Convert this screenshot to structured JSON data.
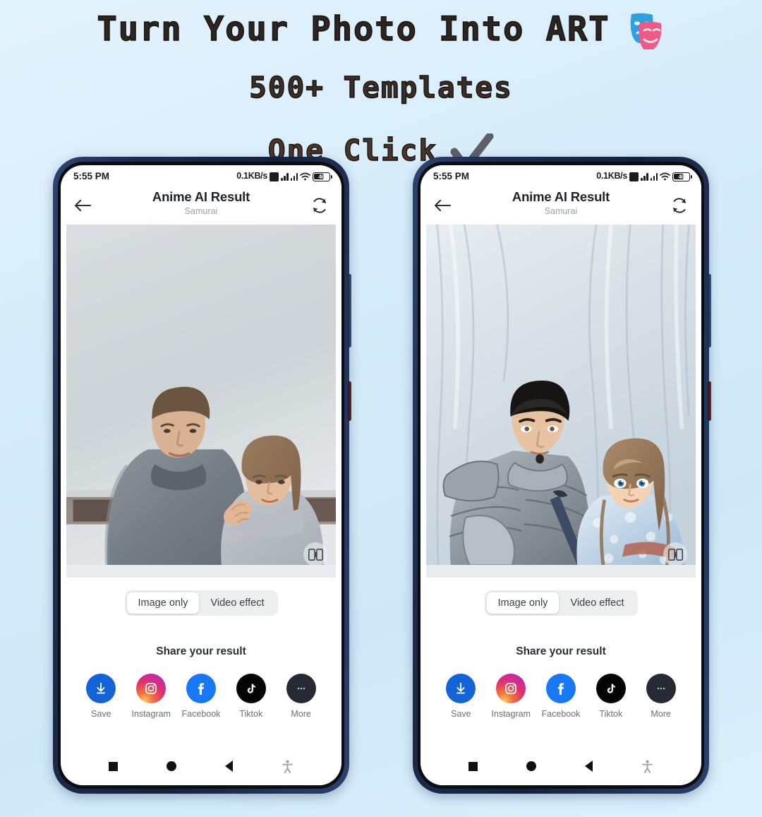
{
  "promo": {
    "headline_1": "Turn Your Photo Into ART",
    "headline_2": "500+ Templates",
    "headline_3": "One Click",
    "masks_icon": "theater-masks-icon",
    "check_icon": "checkmark-icon",
    "background_color": "#d9eefb"
  },
  "phone": {
    "status": {
      "time": "5:55 PM",
      "network_speed": "0.1KB/s",
      "battery_level": "46",
      "icons": [
        "sim-icon",
        "signal-bars-icon",
        "signal-bars-icon",
        "wifi-icon",
        "battery-icon"
      ]
    },
    "appbar": {
      "back": "back-arrow-icon",
      "title": "Anime AI Result",
      "subtitle": "Samurai",
      "refresh": "refresh-icon"
    },
    "artwork": {
      "compare_badge": "compare-toggle-icon"
    },
    "segmented": {
      "options": [
        "Image only",
        "Video effect"
      ],
      "selected": "Image only"
    },
    "share": {
      "title": "Share your result",
      "items": [
        {
          "label": "Save",
          "icon": "download-icon",
          "color": "#1464d8"
        },
        {
          "label": "Instagram",
          "icon": "instagram-icon",
          "color": "#e1306c"
        },
        {
          "label": "Facebook",
          "icon": "facebook-icon",
          "color": "#1877f2"
        },
        {
          "label": "Tiktok",
          "icon": "tiktok-icon",
          "color": "#050505"
        },
        {
          "label": "More",
          "icon": "more-dots-icon",
          "color": "#252a35"
        }
      ]
    },
    "navbar": {
      "items": [
        "recents-square-icon",
        "home-circle-icon",
        "back-triangle-icon",
        "accessibility-icon"
      ]
    }
  },
  "phones": [
    {
      "id": "left-phone",
      "artwork_kind": "original-photo-couple-grey-sweaters"
    },
    {
      "id": "right-phone",
      "artwork_kind": "anime-samurai-couple-result"
    }
  ]
}
